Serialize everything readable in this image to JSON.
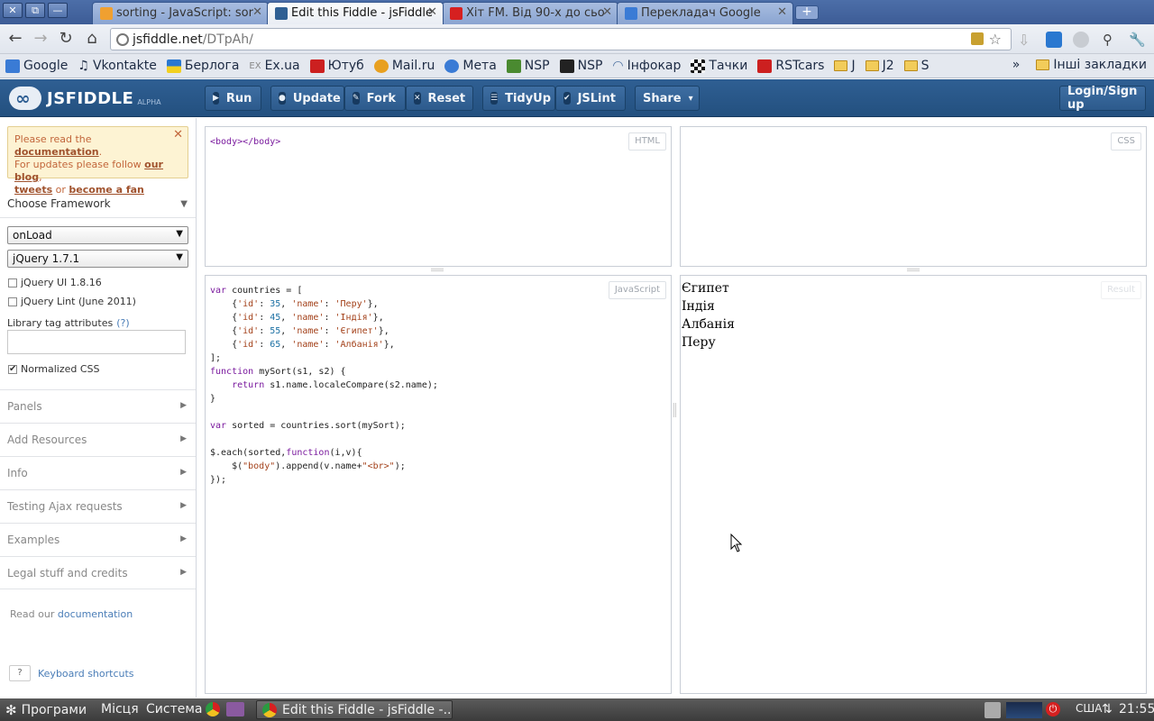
{
  "window": {
    "controls": [
      "✕",
      "⧉",
      "—"
    ]
  },
  "tabs": [
    {
      "title": "sorting - JavaScript: sor",
      "icon_color": "#f0a030",
      "active": false
    },
    {
      "title": "Edit this Fiddle - jsFiddle",
      "icon_color": "#2f5f93",
      "active": true
    },
    {
      "title": "Хіт FM. Від 90-х до сьо",
      "icon_color": "#d62020",
      "active": false
    },
    {
      "title": "Перекладач Google",
      "icon_color": "#3a7bd5",
      "active": false
    }
  ],
  "newtab": "+",
  "address": {
    "host": "jsfiddle.net",
    "path": "/DTpAh/"
  },
  "bookmarks": [
    {
      "label": "Google",
      "color": "#3a7bd5"
    },
    {
      "label": "Vkontakte",
      "color": "#333333"
    },
    {
      "label": "Берлога",
      "color": "#2a78d0"
    },
    {
      "label": "Ex.ua",
      "color": "#888888"
    },
    {
      "label": "Ютуб",
      "color": "#cc2020"
    },
    {
      "label": "Mail.ru",
      "color": "#e8a020"
    },
    {
      "label": "Мета",
      "color": "#3a7bd5"
    },
    {
      "label": "NSP",
      "color": "#4a8a30"
    },
    {
      "label": "NSP",
      "color": "#222222"
    },
    {
      "label": "Інфокар",
      "color": "#4a6fa0"
    },
    {
      "label": "Тачки",
      "color": "#111111"
    },
    {
      "label": "RSTcars",
      "color": "#cc2020"
    },
    {
      "label": "J",
      "folder": true
    },
    {
      "label": "J2",
      "folder": true
    },
    {
      "label": "S",
      "folder": true
    }
  ],
  "bookmarks_more": "»",
  "bookmarks_other": "Інші закладки",
  "jsf": {
    "logo": "JSFIDDLE",
    "alpha": "ALPHA",
    "buttons": [
      {
        "label": "Run",
        "icon": "▶"
      },
      {
        "label": "Update",
        "icon": "●"
      },
      {
        "label": "Fork",
        "icon": "✎"
      },
      {
        "label": "Reset",
        "icon": "✕"
      },
      {
        "label": "TidyUp",
        "icon": "☰"
      },
      {
        "label": "JSLint",
        "icon": "✔"
      },
      {
        "label": "Share",
        "icon": "▾"
      }
    ],
    "login": "Login/Sign up"
  },
  "sidebar": {
    "notice": {
      "pre": "Please read the ",
      "doc": "documentation",
      "mid": "For updates please follow ",
      "blog": "our blog",
      "tweets": "tweets",
      "or": " or ",
      "fan": "become a fan"
    },
    "framework_title": "Choose Framework",
    "load_select": "onLoad",
    "lib_select": "jQuery 1.7.1",
    "chk_ui": "jQuery UI 1.8.16",
    "chk_lint": "jQuery Lint (June 2011)",
    "lib_attr_label": "Library tag attributes",
    "lib_attr_help": "(?)",
    "normalized": "Normalized CSS",
    "rows": [
      "Panels",
      "Add Resources",
      "Info",
      "Testing Ajax requests",
      "Examples",
      "Legal stuff and credits"
    ],
    "read_our": "Read our ",
    "read_doc": "documentation",
    "kbd_key": "?",
    "kbd_label": "Keyboard shortcuts"
  },
  "panels": {
    "html_tag": "HTML",
    "css_tag": "CSS",
    "js_tag": "JavaScript",
    "result_tag": "Result",
    "result_lines": [
      "Єгипет",
      "Індія",
      "Албанія",
      "Перу"
    ]
  },
  "taskbar": {
    "programs": "Програми",
    "places": "Місця",
    "system": "Система",
    "task": "Edit this Fiddle - jsFiddle -...",
    "lang": "США",
    "time": "21:55"
  }
}
